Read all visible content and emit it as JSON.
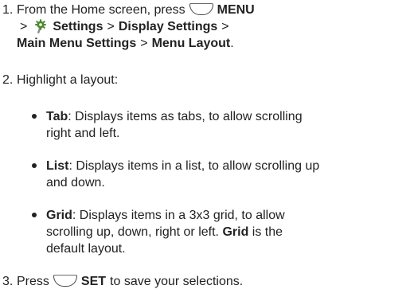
{
  "steps": [
    {
      "number": "1.",
      "text_a": "From the Home screen, press",
      "menu_key": "MENU",
      "sep_a": ">",
      "settings": "Settings",
      "sep_b": ">",
      "display_settings": "Display Settings",
      "sep_c": ">",
      "main_menu_settings": "Main Menu Settings",
      "sep_d": ">",
      "menu_layout": "Menu Layout",
      "period": "."
    },
    {
      "number": "2.",
      "text": "Highlight a layout:"
    },
    {
      "number": "3.",
      "text_a": "Press",
      "set_key": "SET",
      "text_b": "to save your selections."
    }
  ],
  "layouts": [
    {
      "name": "Tab",
      "line1": ": Displays items as tabs, to allow scrolling",
      "line2": "right and left."
    },
    {
      "name": "List",
      "line1": ": Displays items in a list, to allow scrolling up",
      "line2": "and down."
    },
    {
      "name": "Grid",
      "line1": ": Displays items in a 3x3 grid, to allow",
      "line2": "scrolling up, down, right or left.",
      "line2_bold": "Grid",
      "line2_end": "is the",
      "line3": "default layout."
    }
  ],
  "icons": {
    "soft_key": "soft-key-icon",
    "settings": "settings-icon"
  },
  "colors": {
    "text": "#222222",
    "icon_green": "#4f8a2f",
    "icon_gray": "#8a8a8a"
  }
}
